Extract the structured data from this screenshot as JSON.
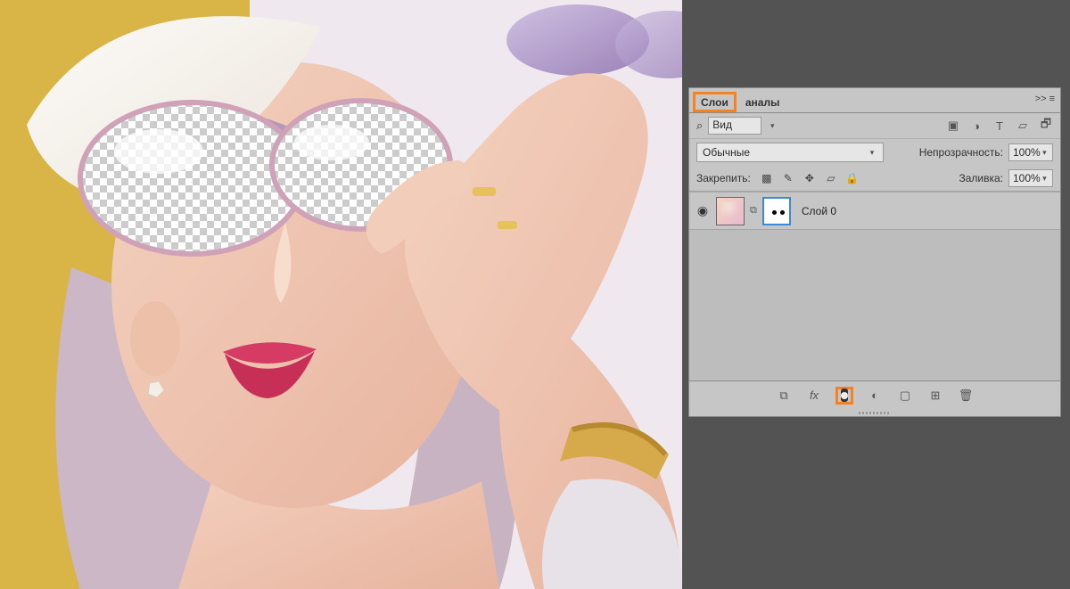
{
  "tabs": {
    "layers": "Слои",
    "channels": "аналы"
  },
  "search": {
    "icon": "⌕",
    "label": "Вид"
  },
  "filters": {
    "image": "▣",
    "adjust": "◑",
    "type": "T",
    "shape": "▱",
    "smart": "🗗"
  },
  "blend": {
    "mode": "Обычные",
    "opacity_label": "Непрозрачность:",
    "opacity_value": "100%"
  },
  "lock": {
    "label": "Закрепить:",
    "fill_label": "Заливка:",
    "fill_value": "100%"
  },
  "layer": {
    "name": "Слой 0"
  },
  "footer": {
    "link": "⧉",
    "fx": "fx",
    "adjust": "◐",
    "group": "▢",
    "new": "⊞",
    "trash": "🗑"
  }
}
